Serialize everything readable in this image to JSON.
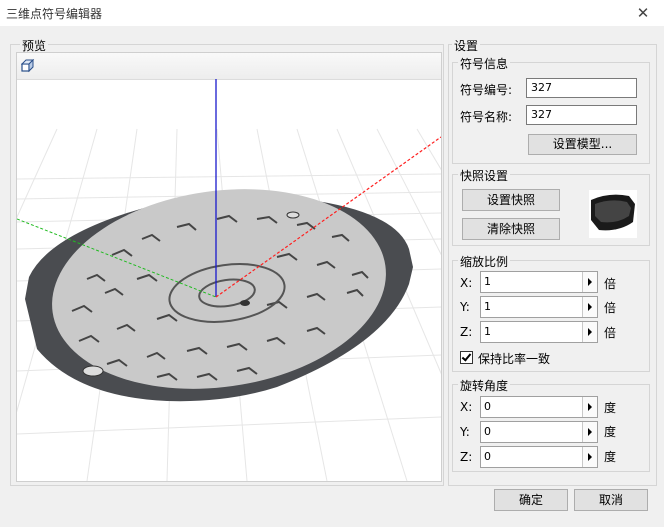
{
  "window": {
    "title": "三维点符号编辑器",
    "close_glyph": "✕"
  },
  "preview": {
    "label": "预览"
  },
  "settings": {
    "label": "设置",
    "symbol_info": {
      "label": "符号信息",
      "id_label": "符号编号:",
      "id_value": "327",
      "name_label": "符号名称:",
      "name_value": "327",
      "model_button": "设置模型..."
    },
    "snapshot": {
      "label": "快照设置",
      "set_button": "设置快照",
      "clear_button": "清除快照"
    },
    "scale": {
      "label": "缩放比例",
      "x_label": "X:",
      "x_value": "1",
      "y_label": "Y:",
      "y_value": "1",
      "z_label": "Z:",
      "z_value": "1",
      "unit": "倍",
      "keep_ratio_label": "保持比率一致",
      "keep_ratio_checked": true
    },
    "rotation": {
      "label": "旋转角度",
      "x_label": "X:",
      "x_value": "0",
      "y_label": "Y:",
      "y_value": "0",
      "z_label": "Z:",
      "z_value": "0",
      "unit": "度"
    }
  },
  "footer": {
    "ok_button": "确定",
    "cancel_button": "取消"
  },
  "colors": {
    "axis_y": "#1a1acc",
    "axis_x": "#ff2020",
    "axis_z": "#22bb22",
    "cover_rim": "#4a4c50",
    "cover_face": "#c9c9c9"
  }
}
